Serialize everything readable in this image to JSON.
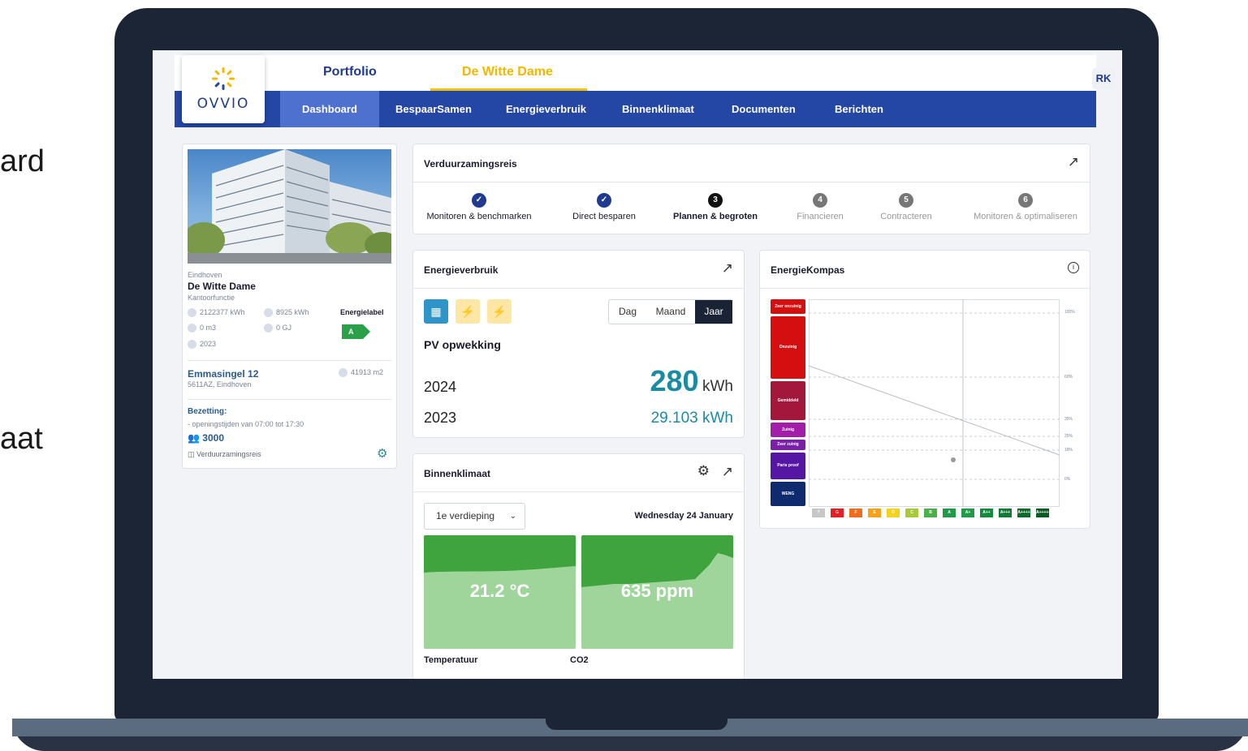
{
  "side": {
    "line1": "ard",
    "line2": "aat"
  },
  "header": {
    "logo_text": "OVVIO",
    "tab_portfolio": "Portfolio",
    "tab_building": "De Witte Dame",
    "user_initials": "RK"
  },
  "nav": {
    "items": [
      "Dashboard",
      "BespaarSamen",
      "Energieverbruik",
      "Binnenklimaat",
      "Documenten",
      "Berichten"
    ]
  },
  "building": {
    "city": "Eindhoven",
    "name": "De Witte Dame",
    "function": "Kantoorfunctie",
    "stat1": "2122377 kWh",
    "stat2": "8925 kWh",
    "stat3": "0 m3",
    "stat4": "0 GJ",
    "stat5": "2023",
    "energielabel_title": "Energielabel",
    "energielabel_value": "A",
    "street": "Emmasingel 12",
    "postal": "5611AZ, Eindhoven",
    "area": "41913 m2",
    "bezetting_title": "Bezetting:",
    "bezetting_detail": "- openingstijden van 07:00 tot 17:30",
    "occupants": "3000",
    "journey_link": "Verduurzamingsreis"
  },
  "journey": {
    "title": "Verduurzamingsreis",
    "steps": [
      {
        "num": "✓",
        "label": "Monitoren & benchmarken"
      },
      {
        "num": "✓",
        "label": "Direct besparen"
      },
      {
        "num": "3",
        "label": "Plannen & begroten"
      },
      {
        "num": "4",
        "label": "Financieren"
      },
      {
        "num": "5",
        "label": "Contracteren"
      },
      {
        "num": "6",
        "label": "Monitoren & optimaliseren"
      }
    ]
  },
  "energy": {
    "title": "Energieverbruik",
    "period_options": [
      "Dag",
      "Maand",
      "Jaar"
    ],
    "selected_period": "Jaar",
    "metric": "PV opwekking",
    "row1_year": "2024",
    "row1_value": "280",
    "row1_unit": "kWh",
    "row2_year": "2023",
    "row2_value": "29.103 kWh"
  },
  "climate": {
    "title": "Binnenklimaat",
    "floor": "1e verdieping",
    "date": "Wednesday 24 January",
    "temp_value": "21.2 °C",
    "temp_label": "Temperatuur",
    "co2_value": "635 ppm",
    "co2_label": "CO2"
  },
  "kompas": {
    "title": "EnergieKompas",
    "classes": [
      "Zeer onzuinig",
      "Onzuinig",
      "Gemiddeld",
      "Zuinig",
      "Zeer zuinig",
      "Paris proof",
      "WENG"
    ],
    "percent_ticks": [
      "100%",
      "60%",
      "35%",
      "25%",
      "18%",
      "0%"
    ],
    "labels": [
      "?",
      "G",
      "F",
      "E",
      "D",
      "C",
      "B",
      "A",
      "A+",
      "A++",
      "A+++",
      "A++++",
      "A+++++"
    ],
    "colors": {
      "zeer_onzuinig": "#d50f0f",
      "onzuinig": "#d50f0f",
      "gemiddeld": "#a3173d",
      "zuinig": "#a21ea8",
      "zeer_zuinig": "#7a1fa8",
      "paris_proof": "#5517a3",
      "weng": "#0f2b6e"
    }
  }
}
